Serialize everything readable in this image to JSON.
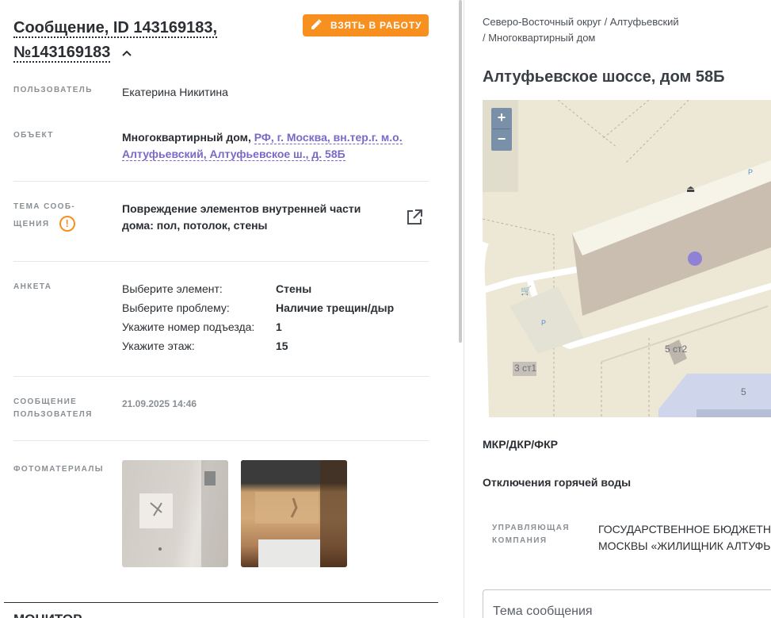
{
  "message": {
    "title_line1": "Сообщение, ID 143169183,",
    "title_line2": "№143169183",
    "take_button": "ВЗЯТЬ В РАБОТУ"
  },
  "fields": {
    "user_label": "ПОЛЬЗОВАТЕЛЬ",
    "user_value": "Екатерина Никитина",
    "object_label": "ОБЪЕКТ",
    "object_type": "Многоквартирный дом, ",
    "object_address": "РФ, г. Москва, вн.тер.г. м.о. Алтуфьевский, Алтуфьевское ш., д. 58Б",
    "topic_label_1": "ТЕМА СООБ-",
    "topic_label_2": "ЩЕНИЯ",
    "topic_value": "Повреждение элементов внутренней части дома: пол, потолок, стены",
    "survey_label": "АНКЕТА",
    "message_label_1": "СООБЩЕНИЕ",
    "message_label_2": "ПОЛЬЗОВАТЕЛЯ",
    "message_date": "21.09.2025 14:46",
    "photos_label": "ФОТОМАТЕРИАЛЫ",
    "bottom_heading": "МОНИТОР"
  },
  "survey": [
    {
      "q": "Выберите элемент:",
      "a": "Стены"
    },
    {
      "q": "Выберите проблему:",
      "a": "Наличие трещин/дыр"
    },
    {
      "q": "Укажите номер подъезда:",
      "a": "1"
    },
    {
      "q": "Укажите этаж:",
      "a": "15"
    }
  ],
  "right": {
    "breadcrumb_1": "Северо-Восточный округ / Алтуфьевский",
    "breadcrumb_2": "/ Многоквартирный дом",
    "address_title": "Алтуфьевское шоссе, дом 58Б",
    "map": {
      "zoom_in": "+",
      "zoom_out": "−",
      "label_5st2": "5 ст2",
      "label_3st1": "3 ст1",
      "label_5": "5",
      "parking": "P"
    },
    "section_1": "МКР/ДКР/ФКР",
    "section_2": "Отключения горячей воды",
    "company_label_1": "УПРАВЛЯЮЩАЯ",
    "company_label_2": "КОМПАНИЯ",
    "company_value_1": "ГОСУДАРСТВЕННОЕ БЮДЖЕТНОЕ",
    "company_value_2": "МОСКВЫ «ЖИЛИЩНИК АЛТУФЬЕ",
    "topic_input_placeholder": "Тема сообщения"
  },
  "colors": {
    "accent_orange": "#f7901e",
    "link_purple": "#7b68c8",
    "map_marker": "#8f82d6"
  }
}
